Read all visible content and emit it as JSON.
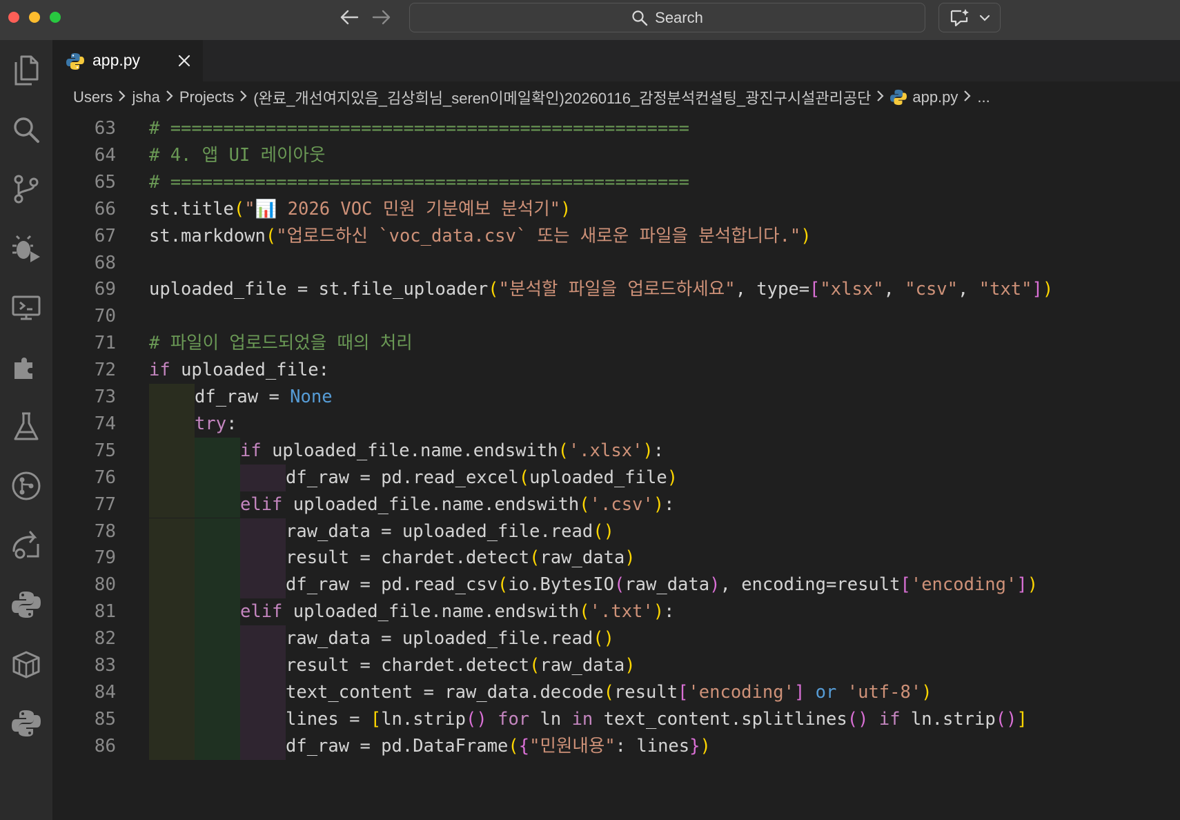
{
  "window": {
    "search_label": "Search"
  },
  "activity_bar": [
    {
      "icon": "files-icon"
    },
    {
      "icon": "search-icon"
    },
    {
      "icon": "source-control-icon"
    },
    {
      "icon": "run-debug-icon"
    },
    {
      "icon": "remote-explorer-icon"
    },
    {
      "icon": "extensions-icon"
    },
    {
      "icon": "testing-icon"
    },
    {
      "icon": "git-graph-icon"
    },
    {
      "icon": "live-share-icon"
    },
    {
      "icon": "python-icon"
    },
    {
      "icon": "packages-icon"
    },
    {
      "icon": "python-environments-icon"
    }
  ],
  "tabs": [
    {
      "label": "app.py",
      "active": true
    }
  ],
  "breadcrumb": {
    "users": "Users",
    "user": "jsha",
    "projects": "Projects",
    "folder": "(완료_개선여지있음_김상희님_seren이메일확인)20260116_감정분석컨설팅_광진구시설관리공단",
    "file": "app.py",
    "more": "..."
  },
  "editor": {
    "language": "python",
    "lines": [
      {
        "n": "63",
        "indent": 0,
        "tokens": [
          [
            "c-com",
            "# ================================================="
          ]
        ]
      },
      {
        "n": "64",
        "indent": 0,
        "tokens": [
          [
            "c-com",
            "# 4. 앱 UI 레이아웃"
          ]
        ]
      },
      {
        "n": "65",
        "indent": 0,
        "tokens": [
          [
            "c-com",
            "# ================================================="
          ]
        ]
      },
      {
        "n": "66",
        "indent": 0,
        "tokens": [
          [
            "",
            "st.title"
          ],
          [
            "c-br1",
            "("
          ],
          [
            "c-str",
            "\"📊 2026 VOC 민원 기분예보 분석기\""
          ],
          [
            "c-br1",
            ")"
          ]
        ]
      },
      {
        "n": "67",
        "indent": 0,
        "tokens": [
          [
            "",
            "st.markdown"
          ],
          [
            "c-br1",
            "("
          ],
          [
            "c-str",
            "\"업로드하신 `voc_data.csv` 또는 새로운 파일을 분석합니다.\""
          ],
          [
            "c-br1",
            ")"
          ]
        ]
      },
      {
        "n": "68",
        "indent": 0,
        "tokens": []
      },
      {
        "n": "69",
        "indent": 0,
        "tokens": [
          [
            "",
            "uploaded_file = st.file_uploader"
          ],
          [
            "c-br1",
            "("
          ],
          [
            "c-str",
            "\"분석할 파일을 업로드하세요\""
          ],
          [
            "",
            ", type="
          ],
          [
            "c-br2",
            "["
          ],
          [
            "c-str",
            "\"xlsx\""
          ],
          [
            "",
            ", "
          ],
          [
            "c-str",
            "\"csv\""
          ],
          [
            "",
            ", "
          ],
          [
            "c-str",
            "\"txt\""
          ],
          [
            "c-br2",
            "]"
          ],
          [
            "c-br1",
            ")"
          ]
        ]
      },
      {
        "n": "70",
        "indent": 0,
        "tokens": []
      },
      {
        "n": "71",
        "indent": 0,
        "tokens": [
          [
            "c-com",
            "# 파일이 업로드되었을 때의 처리"
          ]
        ]
      },
      {
        "n": "72",
        "indent": 0,
        "tokens": [
          [
            "c-ctl",
            "if"
          ],
          [
            "",
            " uploaded_file:"
          ]
        ]
      },
      {
        "n": "73",
        "indent": 1,
        "tokens": [
          [
            "",
            "df_raw = "
          ],
          [
            "c-kw",
            "None"
          ]
        ]
      },
      {
        "n": "74",
        "indent": 1,
        "tokens": [
          [
            "c-ctl",
            "try"
          ],
          [
            "",
            ":"
          ]
        ]
      },
      {
        "n": "75",
        "indent": 2,
        "tokens": [
          [
            "c-ctl",
            "if"
          ],
          [
            "",
            " uploaded_file.name.endswith"
          ],
          [
            "c-br1",
            "("
          ],
          [
            "c-str",
            "'.xlsx'"
          ],
          [
            "c-br1",
            ")"
          ],
          [
            "",
            ":"
          ]
        ]
      },
      {
        "n": "76",
        "indent": 3,
        "tokens": [
          [
            "",
            "df_raw = pd.read_excel"
          ],
          [
            "c-br1",
            "("
          ],
          [
            "",
            "uploaded_file"
          ],
          [
            "c-br1",
            ")"
          ]
        ]
      },
      {
        "n": "77",
        "indent": 2,
        "tokens": [
          [
            "c-ctl",
            "elif"
          ],
          [
            "",
            " uploaded_file.name.endswith"
          ],
          [
            "c-br1",
            "("
          ],
          [
            "c-str",
            "'.csv'"
          ],
          [
            "c-br1",
            ")"
          ],
          [
            "",
            ":"
          ]
        ]
      },
      {
        "n": "78",
        "indent": 3,
        "tokens": [
          [
            "",
            "raw_data = uploaded_file.read"
          ],
          [
            "c-br1",
            "()"
          ]
        ]
      },
      {
        "n": "79",
        "indent": 3,
        "tokens": [
          [
            "",
            "result = chardet.detect"
          ],
          [
            "c-br1",
            "("
          ],
          [
            "",
            "raw_data"
          ],
          [
            "c-br1",
            ")"
          ]
        ]
      },
      {
        "n": "80",
        "indent": 3,
        "tokens": [
          [
            "",
            "df_raw = pd.read_csv"
          ],
          [
            "c-br1",
            "("
          ],
          [
            "",
            "io.BytesIO"
          ],
          [
            "c-br2",
            "("
          ],
          [
            "",
            "raw_data"
          ],
          [
            "c-br2",
            ")"
          ],
          [
            "",
            ", encoding=result"
          ],
          [
            "c-br2",
            "["
          ],
          [
            "c-str",
            "'encoding'"
          ],
          [
            "c-br2",
            "]"
          ],
          [
            "c-br1",
            ")"
          ]
        ]
      },
      {
        "n": "81",
        "indent": 2,
        "tokens": [
          [
            "c-ctl",
            "elif"
          ],
          [
            "",
            " uploaded_file.name.endswith"
          ],
          [
            "c-br1",
            "("
          ],
          [
            "c-str",
            "'.txt'"
          ],
          [
            "c-br1",
            ")"
          ],
          [
            "",
            ":"
          ]
        ]
      },
      {
        "n": "82",
        "indent": 3,
        "tokens": [
          [
            "",
            "raw_data = uploaded_file.read"
          ],
          [
            "c-br1",
            "()"
          ]
        ]
      },
      {
        "n": "83",
        "indent": 3,
        "tokens": [
          [
            "",
            "result = chardet.detect"
          ],
          [
            "c-br1",
            "("
          ],
          [
            "",
            "raw_data"
          ],
          [
            "c-br1",
            ")"
          ]
        ]
      },
      {
        "n": "84",
        "indent": 3,
        "tokens": [
          [
            "",
            "text_content = raw_data.decode"
          ],
          [
            "c-br1",
            "("
          ],
          [
            "",
            "result"
          ],
          [
            "c-br2",
            "["
          ],
          [
            "c-str",
            "'encoding'"
          ],
          [
            "c-br2",
            "]"
          ],
          [
            "",
            " "
          ],
          [
            "c-kw",
            "or"
          ],
          [
            "",
            " "
          ],
          [
            "c-str",
            "'utf-8'"
          ],
          [
            "c-br1",
            ")"
          ]
        ]
      },
      {
        "n": "85",
        "indent": 3,
        "tokens": [
          [
            "",
            "lines = "
          ],
          [
            "c-br1",
            "["
          ],
          [
            "",
            "ln.strip"
          ],
          [
            "c-br2",
            "()"
          ],
          [
            "",
            " "
          ],
          [
            "c-ctl",
            "for"
          ],
          [
            "",
            " ln "
          ],
          [
            "c-ctl",
            "in"
          ],
          [
            "",
            " text_content.splitlines"
          ],
          [
            "c-br2",
            "()"
          ],
          [
            "",
            " "
          ],
          [
            "c-ctl",
            "if"
          ],
          [
            "",
            " ln.strip"
          ],
          [
            "c-br2",
            "()"
          ],
          [
            "c-br1",
            "]"
          ]
        ]
      },
      {
        "n": "86",
        "indent": 3,
        "tokens": [
          [
            "",
            "df_raw = pd.DataFrame"
          ],
          [
            "c-br1",
            "("
          ],
          [
            "c-br2",
            "{"
          ],
          [
            "c-str",
            "\"민원내용\""
          ],
          [
            "",
            ": lines"
          ],
          [
            "c-br2",
            "}"
          ],
          [
            "c-br1",
            ")"
          ]
        ]
      }
    ]
  }
}
